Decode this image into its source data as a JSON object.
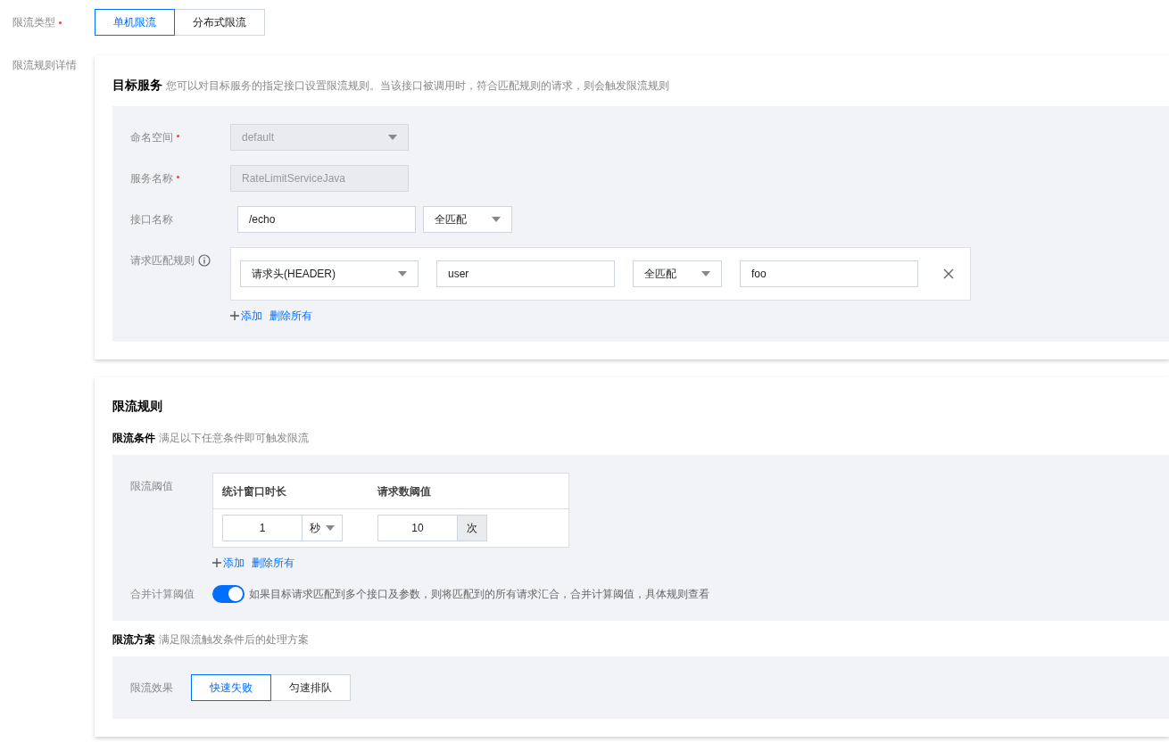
{
  "limit_type": {
    "label": "限流类型",
    "required": true,
    "options": [
      {
        "label": "单机限流",
        "selected": true
      },
      {
        "label": "分布式限流",
        "selected": false
      }
    ]
  },
  "rule_details": {
    "label": "限流规则详情",
    "target_service": {
      "title": "目标服务",
      "description": "您可以对目标服务的指定接口设置限流规则。当该接口被调用时，符合匹配规则的请求，则会触发限流规则",
      "namespace": {
        "label": "命名空间",
        "required": true,
        "value": "default",
        "disabled": true
      },
      "service_name": {
        "label": "服务名称",
        "required": true,
        "value": "RateLimitServiceJava",
        "disabled": true
      },
      "interface_name": {
        "label": "接口名称",
        "value": "/echo",
        "match": "全匹配"
      },
      "match_rules": {
        "label": "请求匹配规则",
        "rows": [
          {
            "type": "请求头(HEADER)",
            "key": "user",
            "match": "全匹配",
            "value": "foo"
          }
        ],
        "add": "添加",
        "delete_all": "删除所有"
      }
    },
    "rate_limit_rule": {
      "title": "限流规则",
      "conditions": {
        "title": "限流条件",
        "description": "满足以下任意条件即可触发限流",
        "threshold": {
          "label": "限流阈值",
          "columns": [
            "统计窗口时长",
            "请求数阈值"
          ],
          "rows": [
            {
              "window": "1",
              "unit": "秒",
              "count": "10",
              "count_unit": "次"
            }
          ],
          "add": "添加",
          "delete_all": "删除所有"
        },
        "merge": {
          "label": "合并计算阈值",
          "on": true,
          "description": "如果目标请求匹配到多个接口及参数，则将匹配到的所有请求汇合，合并计算阈值，具体规则查看"
        }
      },
      "plan": {
        "title": "限流方案",
        "description": "满足限流触发条件后的处理方案",
        "effect": {
          "label": "限流效果",
          "options": [
            {
              "label": "快速失败",
              "selected": true
            },
            {
              "label": "匀速排队",
              "selected": false
            }
          ]
        }
      }
    }
  }
}
